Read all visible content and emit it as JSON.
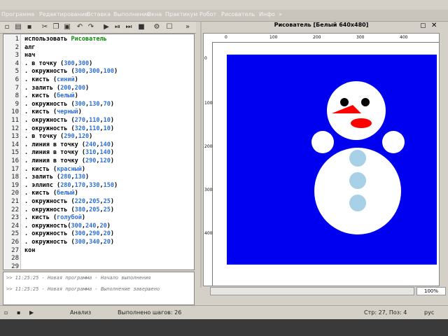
{
  "menubar": {
    "items": [
      "Программа",
      "Редактирование",
      "Вставка",
      "Выполнение",
      "Окна",
      "Практикум",
      "Робот",
      "Рисователь",
      "Инфо",
      "»"
    ]
  },
  "toolbar": {
    "more_label": "»"
  },
  "editor": {
    "lines": [
      {
        "n": "1",
        "parts": [
          {
            "t": "использовать ",
            "c": "kw"
          },
          {
            "t": "Рисователь",
            "c": "green"
          }
        ]
      },
      {
        "n": "2",
        "parts": [
          {
            "t": "алг",
            "c": "kw"
          }
        ]
      },
      {
        "n": "3",
        "parts": [
          {
            "t": "нач",
            "c": "kw"
          }
        ]
      },
      {
        "n": "4",
        "parts": [
          {
            "t": ". в точку (",
            "c": "kw"
          },
          {
            "t": "300",
            "c": "arg"
          },
          {
            "t": ",",
            "c": "kw"
          },
          {
            "t": "300",
            "c": "arg"
          },
          {
            "t": ")",
            "c": "kw"
          }
        ]
      },
      {
        "n": "5",
        "parts": [
          {
            "t": ". окружность (",
            "c": "kw"
          },
          {
            "t": "300",
            "c": "arg"
          },
          {
            "t": ",",
            "c": "kw"
          },
          {
            "t": "300",
            "c": "arg"
          },
          {
            "t": ",",
            "c": "kw"
          },
          {
            "t": "100",
            "c": "arg"
          },
          {
            "t": ")",
            "c": "kw"
          }
        ]
      },
      {
        "n": "6",
        "parts": [
          {
            "t": ". кисть (",
            "c": "kw"
          },
          {
            "t": "синий",
            "c": "arg"
          },
          {
            "t": ")",
            "c": "kw"
          }
        ]
      },
      {
        "n": "7",
        "parts": [
          {
            "t": ". залить (",
            "c": "kw"
          },
          {
            "t": "200",
            "c": "arg"
          },
          {
            "t": ",",
            "c": "kw"
          },
          {
            "t": "200",
            "c": "arg"
          },
          {
            "t": ")",
            "c": "kw"
          }
        ]
      },
      {
        "n": "8",
        "parts": [
          {
            "t": ". кисть (",
            "c": "kw"
          },
          {
            "t": "белый",
            "c": "arg"
          },
          {
            "t": ")",
            "c": "kw"
          }
        ]
      },
      {
        "n": "9",
        "parts": [
          {
            "t": ". окружность (",
            "c": "kw"
          },
          {
            "t": "300",
            "c": "arg"
          },
          {
            "t": ",",
            "c": "kw"
          },
          {
            "t": "130",
            "c": "arg"
          },
          {
            "t": ",",
            "c": "kw"
          },
          {
            "t": "70",
            "c": "arg"
          },
          {
            "t": ")",
            "c": "kw"
          }
        ]
      },
      {
        "n": "10",
        "parts": [
          {
            "t": ". кисть (",
            "c": "kw"
          },
          {
            "t": "черный",
            "c": "arg"
          },
          {
            "t": ")",
            "c": "kw"
          }
        ]
      },
      {
        "n": "11",
        "parts": [
          {
            "t": ". окружность (",
            "c": "kw"
          },
          {
            "t": "270",
            "c": "arg"
          },
          {
            "t": ",",
            "c": "kw"
          },
          {
            "t": "110",
            "c": "arg"
          },
          {
            "t": ",",
            "c": "kw"
          },
          {
            "t": "10",
            "c": "arg"
          },
          {
            "t": ")",
            "c": "kw"
          }
        ]
      },
      {
        "n": "12",
        "parts": [
          {
            "t": ". окружность (",
            "c": "kw"
          },
          {
            "t": "320",
            "c": "arg"
          },
          {
            "t": ",",
            "c": "kw"
          },
          {
            "t": "110",
            "c": "arg"
          },
          {
            "t": ",",
            "c": "kw"
          },
          {
            "t": "10",
            "c": "arg"
          },
          {
            "t": ")",
            "c": "kw"
          }
        ]
      },
      {
        "n": "13",
        "parts": [
          {
            "t": ". в точку (",
            "c": "kw"
          },
          {
            "t": "290",
            "c": "arg"
          },
          {
            "t": ",",
            "c": "kw"
          },
          {
            "t": "120",
            "c": "arg"
          },
          {
            "t": ")",
            "c": "kw"
          }
        ]
      },
      {
        "n": "14",
        "parts": [
          {
            "t": ". линия в точку (",
            "c": "kw"
          },
          {
            "t": "240",
            "c": "arg"
          },
          {
            "t": ",",
            "c": "kw"
          },
          {
            "t": "140",
            "c": "arg"
          },
          {
            "t": ")",
            "c": "kw"
          }
        ]
      },
      {
        "n": "15",
        "parts": [
          {
            "t": ". линия в точку (",
            "c": "kw"
          },
          {
            "t": "310",
            "c": "arg"
          },
          {
            "t": ",",
            "c": "kw"
          },
          {
            "t": "140",
            "c": "arg"
          },
          {
            "t": ")",
            "c": "kw"
          }
        ]
      },
      {
        "n": "16",
        "parts": [
          {
            "t": ". линия в точку (",
            "c": "kw"
          },
          {
            "t": "290",
            "c": "arg"
          },
          {
            "t": ",",
            "c": "kw"
          },
          {
            "t": "120",
            "c": "arg"
          },
          {
            "t": ")",
            "c": "kw"
          }
        ]
      },
      {
        "n": "17",
        "parts": [
          {
            "t": ". кисть (",
            "c": "kw"
          },
          {
            "t": "красный",
            "c": "arg"
          },
          {
            "t": ")",
            "c": "kw"
          }
        ]
      },
      {
        "n": "18",
        "parts": [
          {
            "t": ". залить (",
            "c": "kw"
          },
          {
            "t": "280",
            "c": "arg"
          },
          {
            "t": ",",
            "c": "kw"
          },
          {
            "t": "130",
            "c": "arg"
          },
          {
            "t": ")",
            "c": "kw"
          }
        ]
      },
      {
        "n": "19",
        "parts": [
          {
            "t": ". эллипс (",
            "c": "kw"
          },
          {
            "t": "280",
            "c": "arg"
          },
          {
            "t": ",",
            "c": "kw"
          },
          {
            "t": "170",
            "c": "arg"
          },
          {
            "t": ",",
            "c": "kw"
          },
          {
            "t": "330",
            "c": "arg"
          },
          {
            "t": ",",
            "c": "kw"
          },
          {
            "t": "150",
            "c": "arg"
          },
          {
            "t": ")",
            "c": "kw"
          }
        ]
      },
      {
        "n": "20",
        "parts": [
          {
            "t": ". кисть (",
            "c": "kw"
          },
          {
            "t": "белый",
            "c": "arg"
          },
          {
            "t": ")",
            "c": "kw"
          }
        ]
      },
      {
        "n": "21",
        "parts": [
          {
            "t": ". окружность (",
            "c": "kw"
          },
          {
            "t": "220",
            "c": "arg"
          },
          {
            "t": ",",
            "c": "kw"
          },
          {
            "t": "205",
            "c": "arg"
          },
          {
            "t": ",",
            "c": "kw"
          },
          {
            "t": "25",
            "c": "arg"
          },
          {
            "t": ")",
            "c": "kw"
          }
        ]
      },
      {
        "n": "22",
        "parts": [
          {
            "t": ". окружность (",
            "c": "kw"
          },
          {
            "t": "380",
            "c": "arg"
          },
          {
            "t": ",",
            "c": "kw"
          },
          {
            "t": "205",
            "c": "arg"
          },
          {
            "t": ",",
            "c": "kw"
          },
          {
            "t": "25",
            "c": "arg"
          },
          {
            "t": ")",
            "c": "kw"
          }
        ]
      },
      {
        "n": "23",
        "parts": [
          {
            "t": ". кисть (",
            "c": "kw"
          },
          {
            "t": "голубой",
            "c": "arg"
          },
          {
            "t": ")",
            "c": "kw"
          }
        ]
      },
      {
        "n": "24",
        "parts": [
          {
            "t": ". окружность(",
            "c": "kw"
          },
          {
            "t": "300",
            "c": "arg"
          },
          {
            "t": ",",
            "c": "kw"
          },
          {
            "t": "240",
            "c": "arg"
          },
          {
            "t": ",",
            "c": "kw"
          },
          {
            "t": "20",
            "c": "arg"
          },
          {
            "t": ")",
            "c": "kw"
          }
        ]
      },
      {
        "n": "25",
        "parts": [
          {
            "t": ". окружность (",
            "c": "kw"
          },
          {
            "t": "300",
            "c": "arg"
          },
          {
            "t": ",",
            "c": "kw"
          },
          {
            "t": "290",
            "c": "arg"
          },
          {
            "t": ",",
            "c": "kw"
          },
          {
            "t": "20",
            "c": "arg"
          },
          {
            "t": ")",
            "c": "kw"
          }
        ]
      },
      {
        "n": "26",
        "parts": [
          {
            "t": ". окружность (",
            "c": "kw"
          },
          {
            "t": "300",
            "c": "arg"
          },
          {
            "t": ",",
            "c": "kw"
          },
          {
            "t": "340",
            "c": "arg"
          },
          {
            "t": ",",
            "c": "kw"
          },
          {
            "t": "20",
            "c": "arg"
          },
          {
            "t": ")",
            "c": "kw"
          }
        ]
      },
      {
        "n": "27",
        "parts": [
          {
            "t": "кон",
            "c": "kw"
          }
        ]
      },
      {
        "n": "28",
        "parts": []
      },
      {
        "n": "29",
        "parts": []
      }
    ]
  },
  "console": {
    "lines": [
      ">> 11:25:25 - Новая программа - Начало выполнения",
      ">> 11:25:25 - Новая программа - Выполнение завершено"
    ]
  },
  "drawing_window": {
    "title": "Рисователь [Белый 640x480]",
    "ruler_top": [
      "0",
      "100",
      "200",
      "300",
      "400"
    ],
    "ruler_left": [
      "0",
      "100",
      "200",
      "300",
      "400"
    ],
    "canvas_bg": "#0000f0",
    "zoom": "100%"
  },
  "statusbar": {
    "mode": "Анализ",
    "steps": "Выполнено шагов: 26",
    "position": "Стр: 27, Поз: 4",
    "keyboard": "рус"
  },
  "colors": {
    "blue": "#0000f0",
    "red": "#ff0000",
    "light_blue": "#a8d0e6",
    "white": "#ffffff",
    "black": "#000000"
  }
}
